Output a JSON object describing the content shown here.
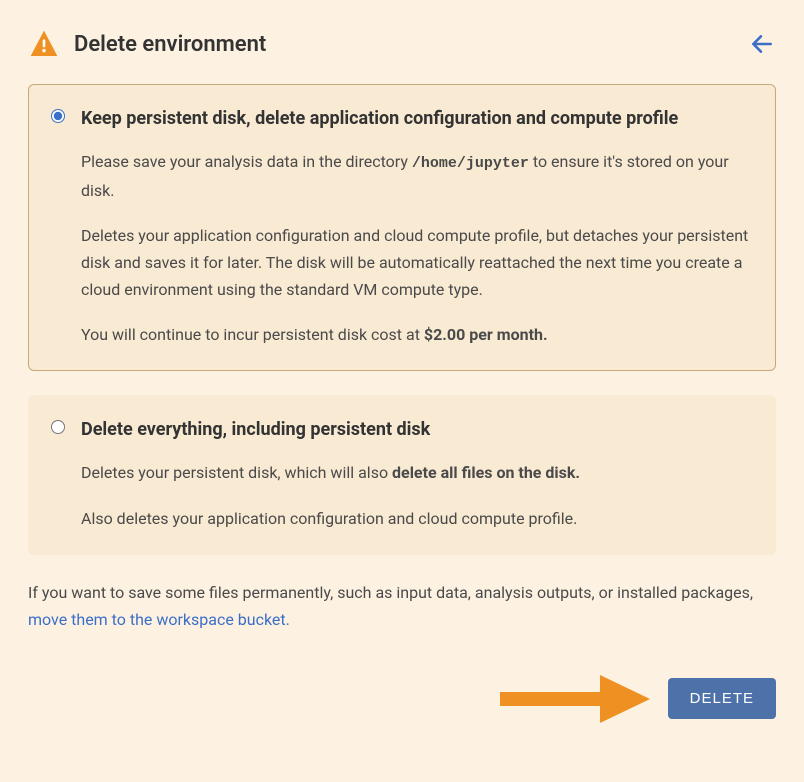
{
  "header": {
    "title": "Delete environment"
  },
  "options": {
    "keep_disk": {
      "title": "Keep persistent disk, delete application configuration and compute profile",
      "p1_pre": "Please save your analysis data in the directory ",
      "p1_path": "/home/jupyter",
      "p1_post": " to ensure it's stored on your disk.",
      "p2": "Deletes your application configuration and cloud compute profile, but detaches your persistent disk and saves it for later. The disk will be automatically reattached the next time you create a cloud environment using the standard VM compute type.",
      "p3_pre": "You will continue to incur persistent disk cost at ",
      "p3_bold": "$2.00 per month.",
      "selected": true
    },
    "delete_all": {
      "title": "Delete everything, including persistent disk",
      "p1_pre": "Deletes your persistent disk, which will also ",
      "p1_bold": "delete all files on the disk.",
      "p2": "Also deletes your application configuration and cloud compute profile.",
      "selected": false
    }
  },
  "footer": {
    "text_pre": "If you want to save some files permanently, such as input data, analysis outputs, or installed packages, ",
    "link_text": "move them to the workspace bucket.",
    "text_post": ""
  },
  "actions": {
    "delete_label": "DELETE"
  },
  "colors": {
    "accent_blue": "#3b6ec7",
    "button_blue": "#4d72aa",
    "warn_orange": "#ee9122"
  }
}
